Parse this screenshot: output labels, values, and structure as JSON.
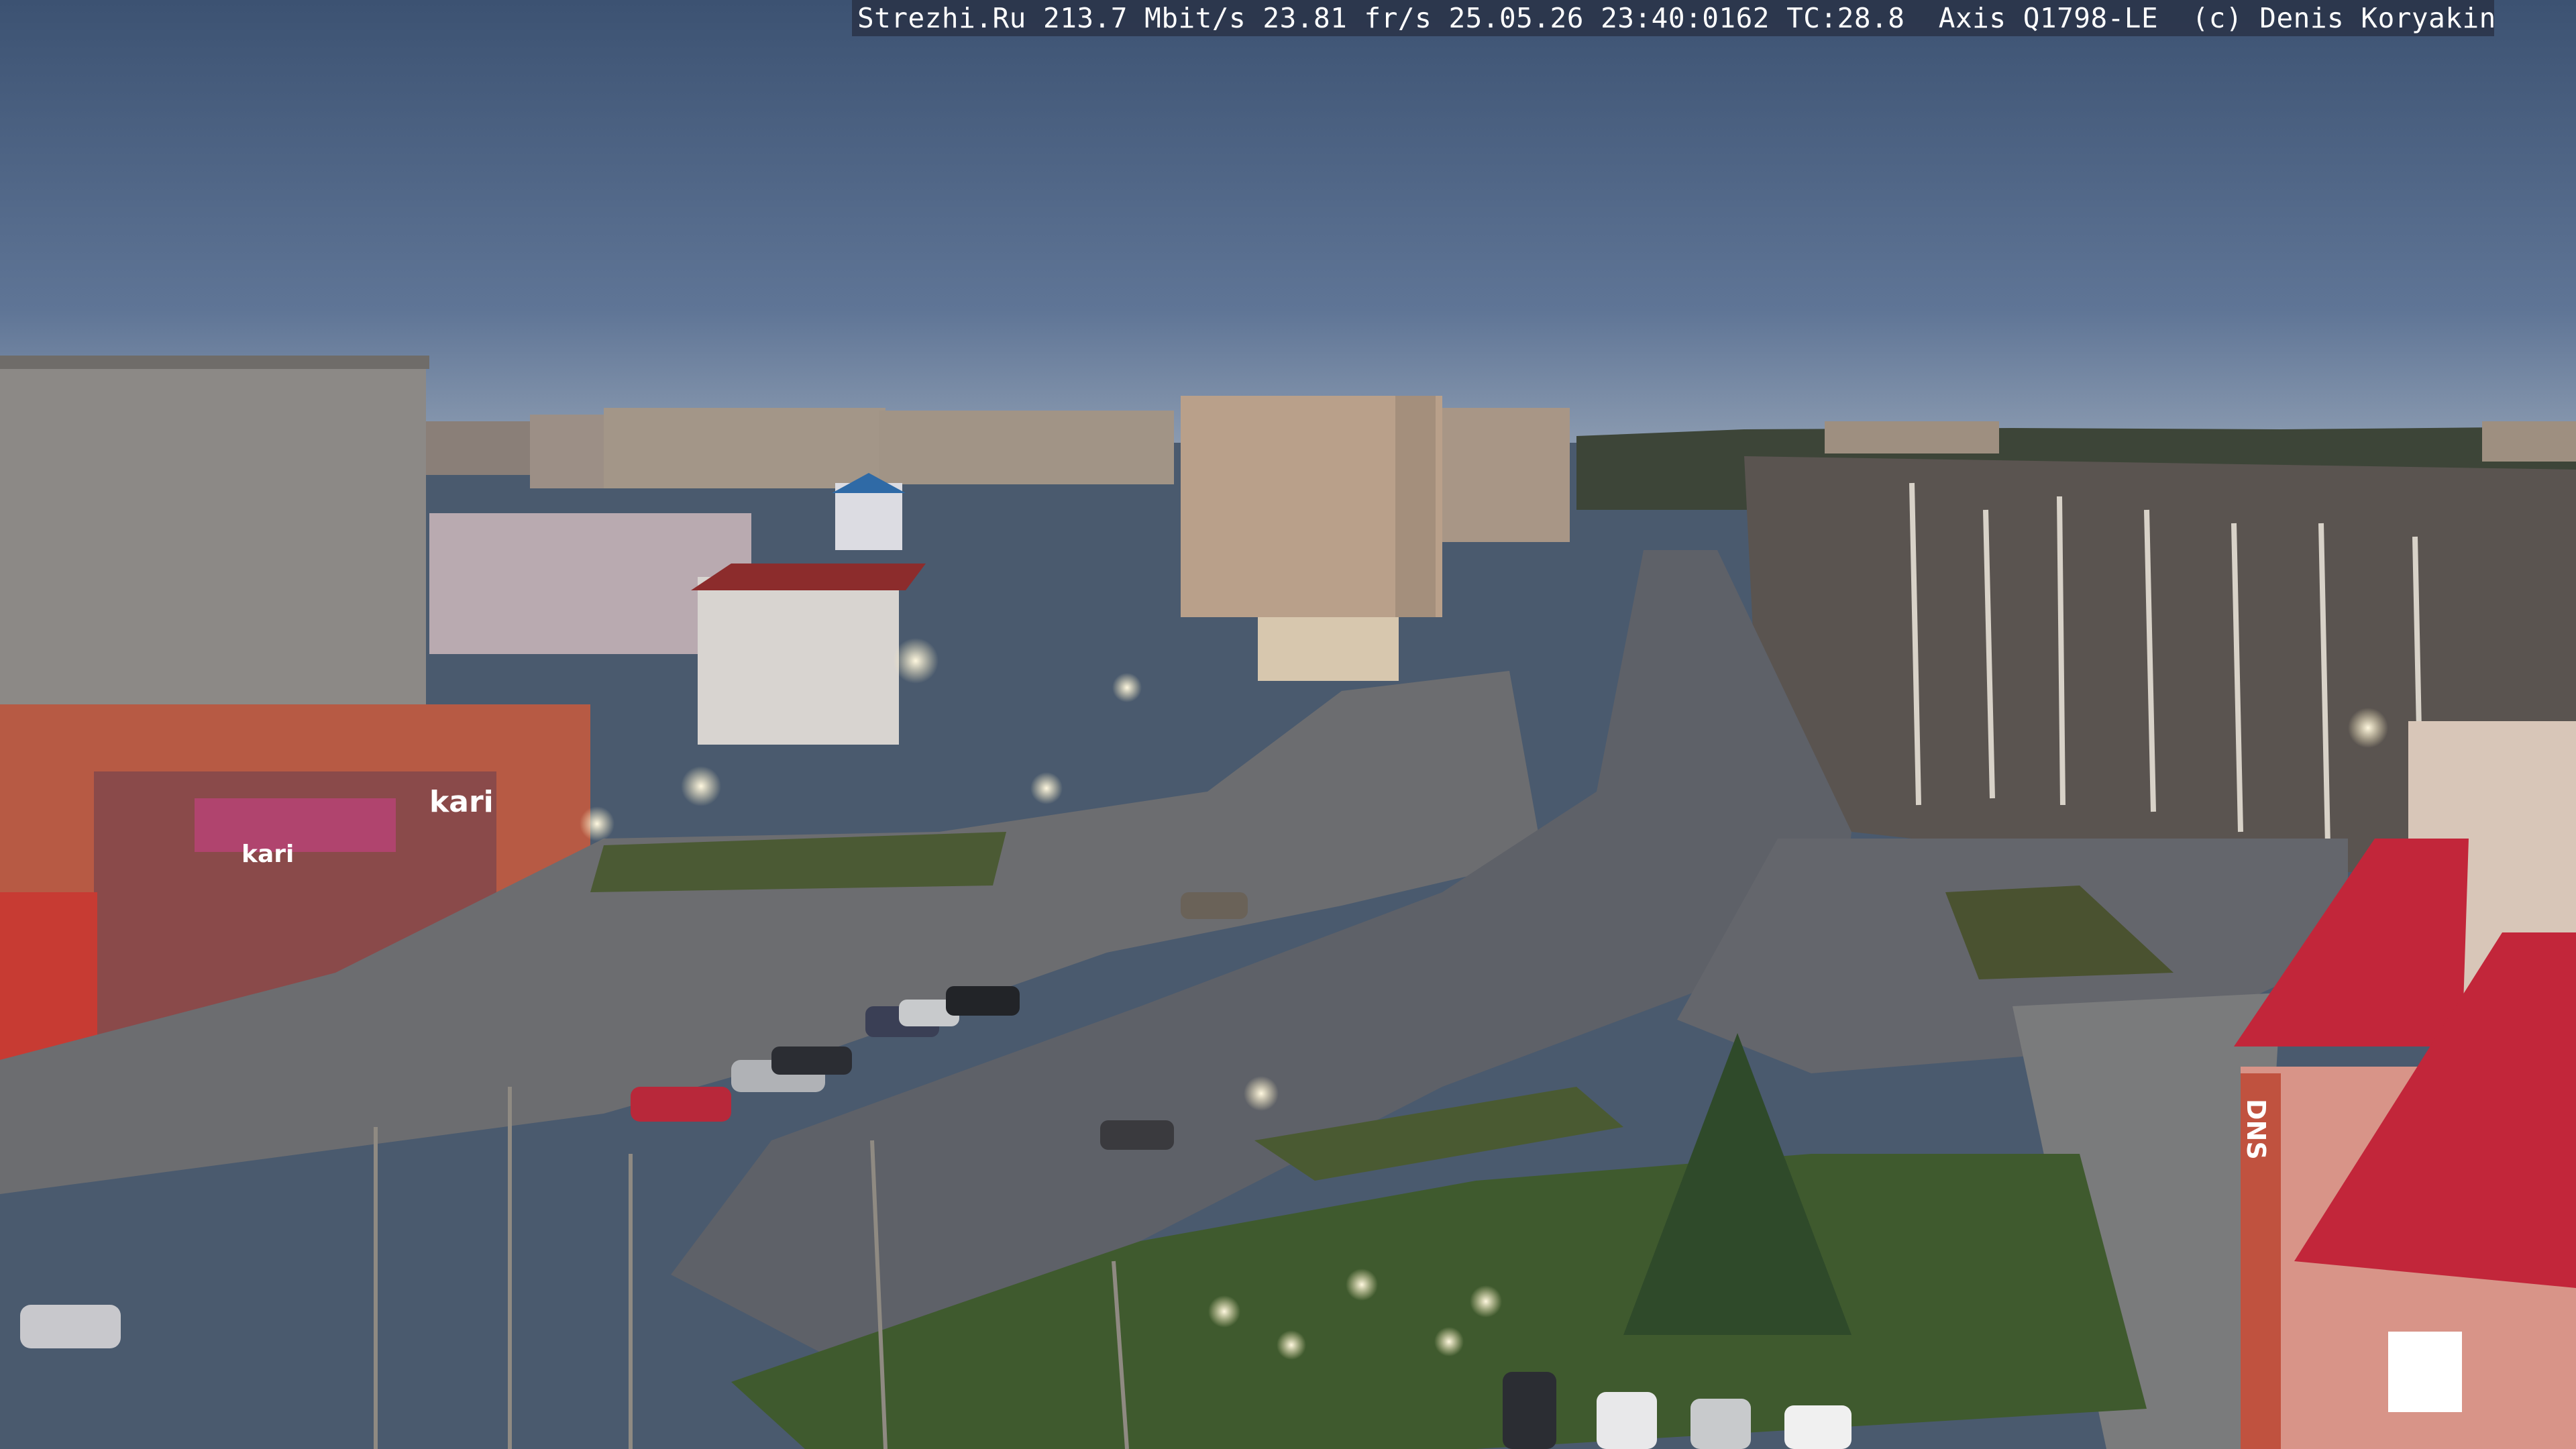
{
  "overlay": {
    "text": "Strezhi.Ru 213.7 Mbit/s 23.81 fr/s 25.05.26 23:40:0162 TC:28.8  Axis Q1798-LE  (c) Denis Koryakin"
  },
  "signs": {
    "store_1": "kari",
    "store_2": "kari",
    "store_3": "DNS"
  },
  "colors": {
    "sky_top": "#3f5573",
    "sky_bottom": "#6f86a6",
    "road": "#5c6068",
    "grass": "#3f5a2e",
    "roof_red": "#c2263a"
  }
}
